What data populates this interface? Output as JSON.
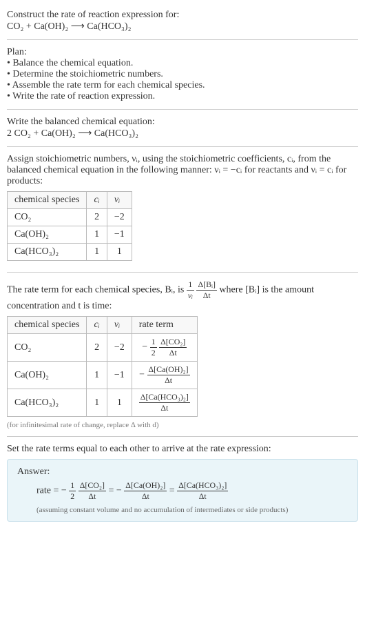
{
  "prompt": {
    "line1": "Construct the rate of reaction expression for:",
    "equation": "CO₂ + Ca(OH)₂ ⟶ Ca(HCO₃)₂"
  },
  "plan": {
    "heading": "Plan:",
    "items": [
      "Balance the chemical equation.",
      "Determine the stoichiometric numbers.",
      "Assemble the rate term for each chemical species.",
      "Write the rate of reaction expression."
    ]
  },
  "balanced": {
    "heading": "Write the balanced chemical equation:",
    "equation": "2 CO₂ + Ca(OH)₂ ⟶ Ca(HCO₃)₂"
  },
  "stoich_intro": "Assign stoichiometric numbers, νᵢ, using the stoichiometric coefficients, cᵢ, from the balanced chemical equation in the following manner: νᵢ = −cᵢ for reactants and νᵢ = cᵢ for products:",
  "table1": {
    "headers": [
      "chemical species",
      "cᵢ",
      "νᵢ"
    ],
    "rows": [
      {
        "species": "CO₂",
        "c": "2",
        "nu": "−2"
      },
      {
        "species": "Ca(OH)₂",
        "c": "1",
        "nu": "−1"
      },
      {
        "species": "Ca(HCO₃)₂",
        "c": "1",
        "nu": "1"
      }
    ]
  },
  "rate_intro_pre": "The rate term for each chemical species, Bᵢ, is ",
  "rate_intro_post": " where [Bᵢ] is the amount concentration and t is time:",
  "rate_frac_outer_num": "1",
  "rate_frac_outer_den": "νᵢ",
  "rate_frac_inner_num": "Δ[Bᵢ]",
  "rate_frac_inner_den": "Δt",
  "table2": {
    "headers": [
      "chemical species",
      "cᵢ",
      "νᵢ",
      "rate term"
    ],
    "rows": [
      {
        "species": "CO₂",
        "c": "2",
        "nu": "−2",
        "rate_prefix": "−",
        "coef_num": "1",
        "coef_den": "2",
        "dnum": "Δ[CO₂]",
        "dden": "Δt"
      },
      {
        "species": "Ca(OH)₂",
        "c": "1",
        "nu": "−1",
        "rate_prefix": "−",
        "coef_num": "",
        "coef_den": "",
        "dnum": "Δ[Ca(OH)₂]",
        "dden": "Δt"
      },
      {
        "species": "Ca(HCO₃)₂",
        "c": "1",
        "nu": "1",
        "rate_prefix": "",
        "coef_num": "",
        "coef_den": "",
        "dnum": "Δ[Ca(HCO₃)₂]",
        "dden": "Δt"
      }
    ]
  },
  "infinitesimal_note": "(for infinitesimal rate of change, replace Δ with d)",
  "final_heading": "Set the rate terms equal to each other to arrive at the rate expression:",
  "answer": {
    "label": "Answer:",
    "rate_label": "rate = ",
    "t1_prefix": "−",
    "t1_cnum": "1",
    "t1_cden": "2",
    "t1_num": "Δ[CO₂]",
    "t1_den": "Δt",
    "eq1": " = ",
    "t2_prefix": "−",
    "t2_num": "Δ[Ca(OH)₂]",
    "t2_den": "Δt",
    "eq2": " = ",
    "t3_num": "Δ[Ca(HCO₃)₂]",
    "t3_den": "Δt",
    "footnote": "(assuming constant volume and no accumulation of intermediates or side products)"
  }
}
